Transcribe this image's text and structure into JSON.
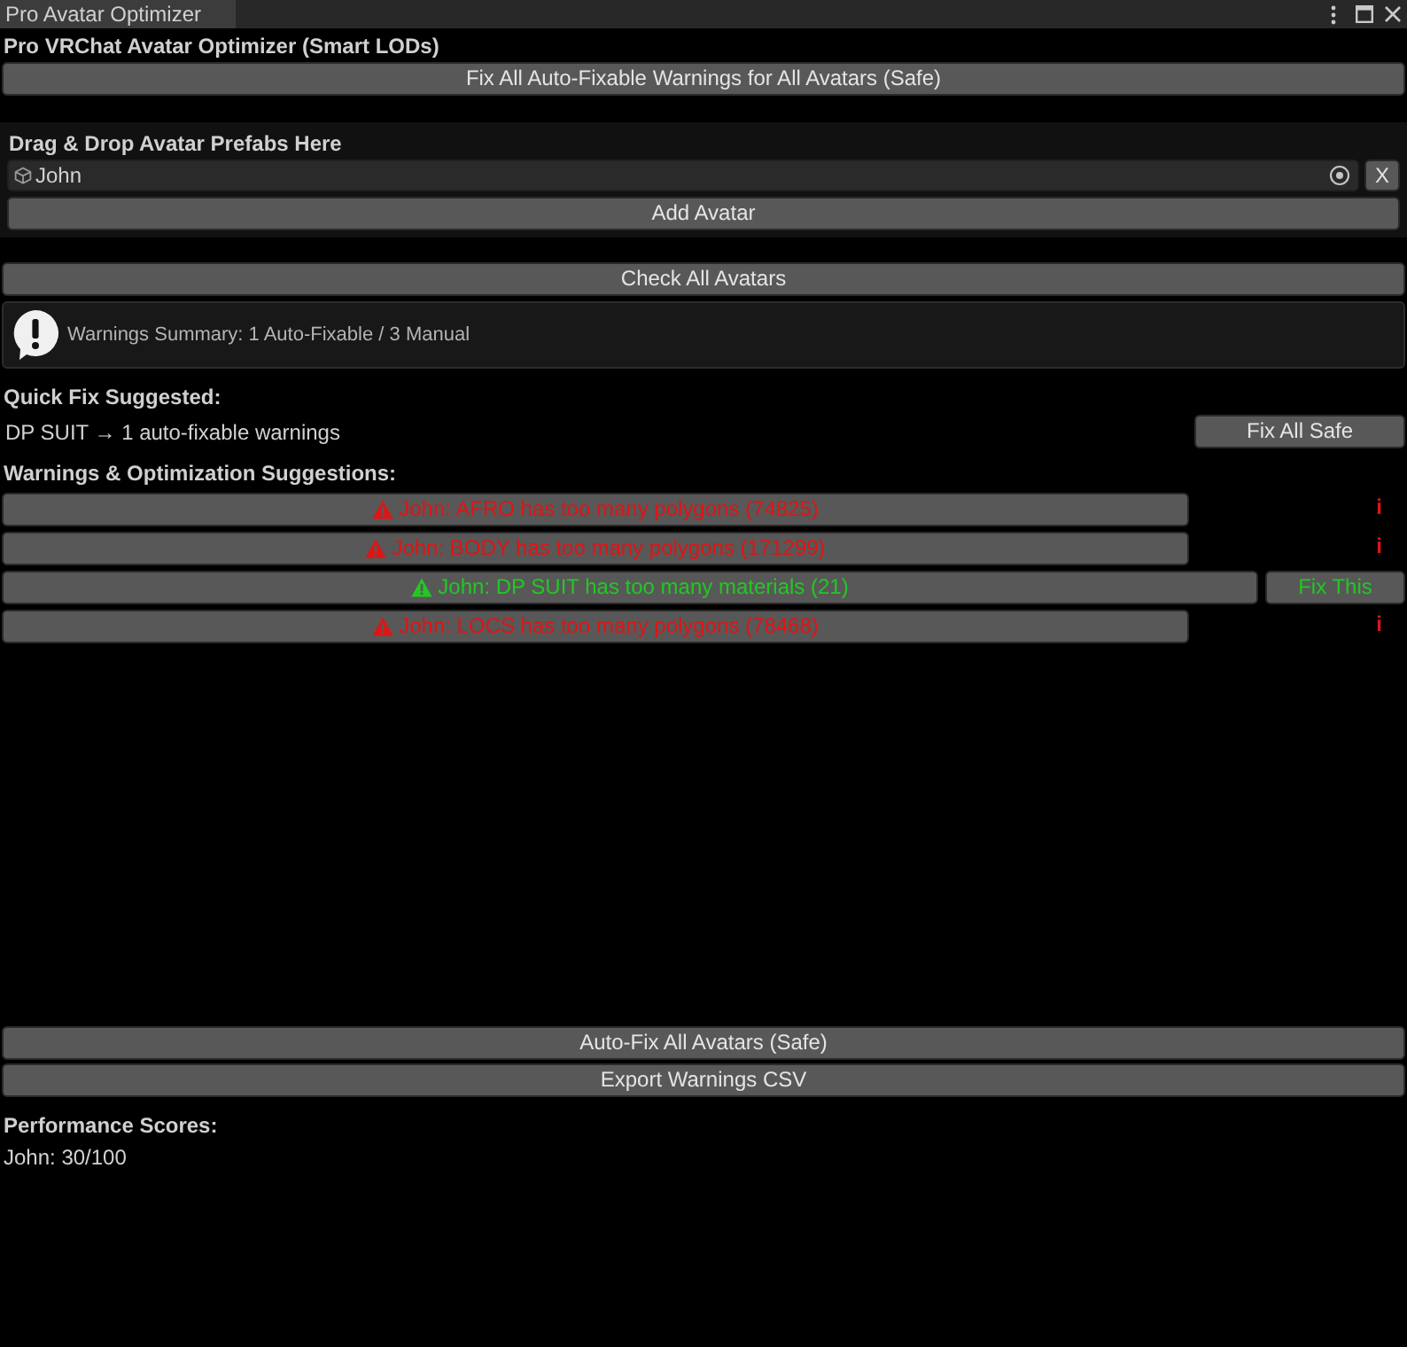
{
  "window": {
    "tab_title": "Pro Avatar Optimizer"
  },
  "header": {
    "title": "Pro VRChat Avatar Optimizer (Smart LODs)",
    "fix_all_button": "Fix All Auto-Fixable Warnings for All Avatars (Safe)"
  },
  "drop_panel": {
    "label": "Drag & Drop Avatar Prefabs Here",
    "avatar_field": {
      "value": "John"
    },
    "remove_button": "X",
    "add_button": "Add Avatar"
  },
  "check_button": "Check All Avatars",
  "summary": {
    "text": "Warnings Summary: 1 Auto-Fixable / 3 Manual"
  },
  "quick_fix": {
    "heading": "Quick Fix Suggested:",
    "text": "DP SUIT → 1 auto-fixable warnings",
    "button": "Fix All Safe"
  },
  "warnings": {
    "heading": "Warnings & Optimization Suggestions:",
    "items": [
      {
        "kind": "manual",
        "text": "John: AFRO has too many polygons (74825)",
        "info": "i"
      },
      {
        "kind": "manual",
        "text": "John: BODY has too many polygons (171299)",
        "info": "i"
      },
      {
        "kind": "fixable",
        "text": "John: DP SUIT has too many materials (21)",
        "fix_button": "Fix This"
      },
      {
        "kind": "manual",
        "text": "John: LOCS has too many polygons (78468)",
        "info": "i"
      }
    ]
  },
  "bottom_buttons": [
    "Auto-Fix All Avatars (Safe)",
    "Export Warnings CSV"
  ],
  "performance": {
    "heading": "Performance Scores:",
    "scores": [
      "John: 30/100"
    ]
  }
}
